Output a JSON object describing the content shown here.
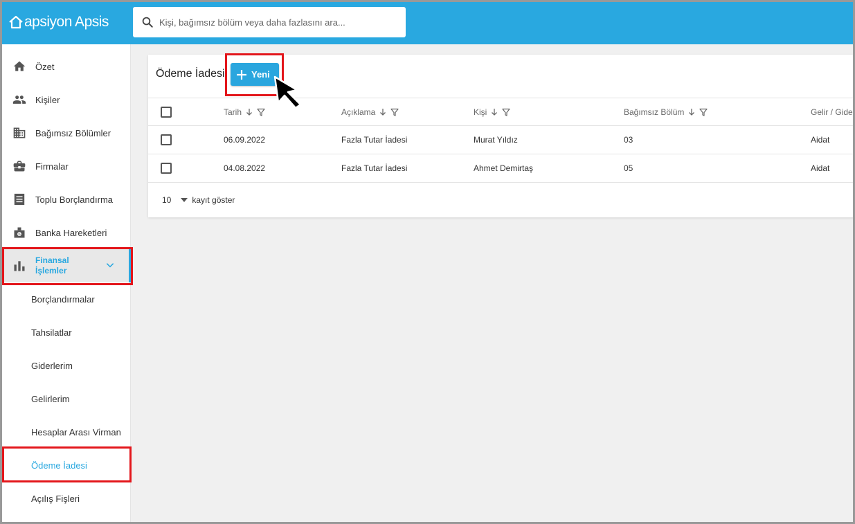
{
  "app": {
    "name": "apsiyon Apsis"
  },
  "search": {
    "placeholder": "Kişi, bağımsız bölüm veya daha fazlasını ara..."
  },
  "sidebar": {
    "items": [
      {
        "label": "Özet",
        "icon": "home-icon"
      },
      {
        "label": "Kişiler",
        "icon": "people-icon"
      },
      {
        "label": "Bağımsız Bölümler",
        "icon": "building-icon"
      },
      {
        "label": "Firmalar",
        "icon": "briefcase-icon"
      },
      {
        "label": "Toplu Borçlandırma",
        "icon": "ledger-icon"
      },
      {
        "label": "Banka Hareketleri",
        "icon": "bank-icon"
      },
      {
        "label": "Finansal İşlemler",
        "icon": "bar-chart-icon"
      }
    ],
    "subitems": [
      {
        "label": "Borçlandırmalar"
      },
      {
        "label": "Tahsilatlar"
      },
      {
        "label": "Giderlerim"
      },
      {
        "label": "Gelirlerim"
      },
      {
        "label": "Hesaplar Arası Virman"
      },
      {
        "label": "Ödeme İadesi"
      },
      {
        "label": "Açılış Fişleri"
      }
    ]
  },
  "main": {
    "title": "Ödeme İadesi",
    "new_button": "Yeni",
    "columns": [
      "Tarih",
      "Açıklama",
      "Kişi",
      "Bağımsız Bölüm",
      "Gelir / Gider"
    ],
    "rows": [
      [
        "06.09.2022",
        "Fazla Tutar İadesi",
        "Murat Yıldız",
        "03",
        "Aidat"
      ],
      [
        "04.08.2022",
        "Fazla Tutar İadesi",
        "Ahmet Demirtaş",
        "05",
        "Aidat"
      ]
    ],
    "page_size": "10",
    "page_size_label": "kayıt göster"
  },
  "colors": {
    "brand": "#29a8e0",
    "highlight": "#e3161b"
  }
}
